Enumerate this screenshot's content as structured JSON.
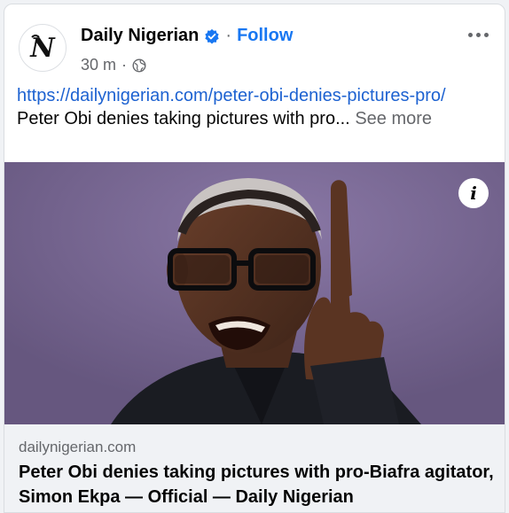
{
  "post": {
    "page_name": "Daily Nigerian",
    "separator": "·",
    "follow_label": "Follow",
    "time": "30 m",
    "time_separator": "·",
    "audience_icon": "globe-icon",
    "more_icon": "more-options-icon",
    "link_text": "https://dailynigerian.com/peter-obi-denies-pictures-pro/",
    "excerpt": "Peter Obi denies taking pictures with pro...",
    "see_more_label": "See more"
  },
  "image": {
    "info_label": "i"
  },
  "preview": {
    "domain": "dailynigerian.com",
    "headline": "Peter Obi denies taking pictures with pro-Biafra agitator, Simon Ekpa — Official — Daily Nigerian"
  },
  "colors": {
    "accent": "#1877f2",
    "link": "#1d62d1",
    "muted": "#65676b",
    "photo_bg": "#73628e"
  }
}
